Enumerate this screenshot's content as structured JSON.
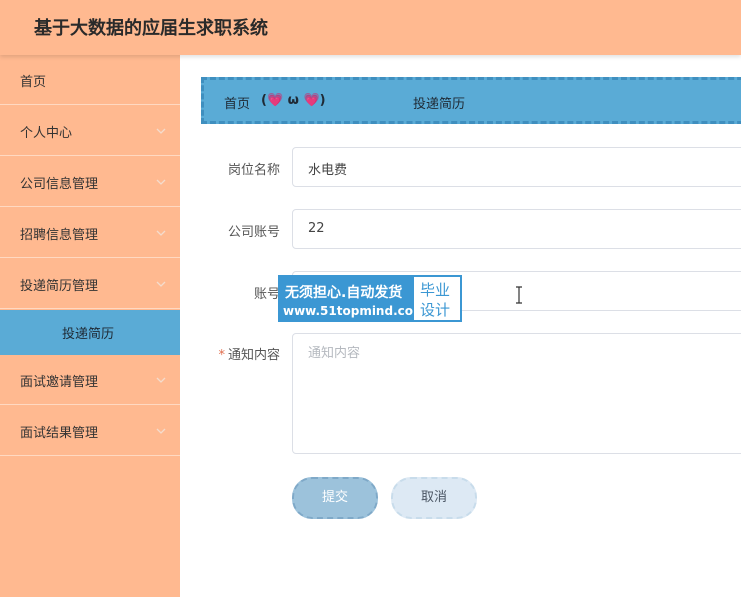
{
  "header": {
    "title": "基于大数据的应届生求职系统"
  },
  "sidebar": {
    "items": [
      {
        "label": "首页"
      },
      {
        "label": "个人中心"
      },
      {
        "label": "公司信息管理"
      },
      {
        "label": "招聘信息管理"
      },
      {
        "label": "投递简历管理"
      },
      {
        "label": "面试邀请管理"
      },
      {
        "label": "面试结果管理"
      }
    ],
    "active_sub": {
      "label": "投递简历"
    }
  },
  "breadcrumb": {
    "home": "首页",
    "separator": "(💗 ω 💗)",
    "current": "投递简历"
  },
  "form": {
    "position_name": {
      "label": "岗位名称",
      "value": "水电费"
    },
    "company_account": {
      "label": "公司账号",
      "value": "22"
    },
    "account": {
      "label": "账号"
    },
    "notice_content": {
      "required_mark": "*",
      "label": "通知内容",
      "placeholder": "通知内容"
    },
    "submit_label": "提交",
    "cancel_label": "取消"
  },
  "watermark": {
    "line1": "无须担心.自动发货",
    "line2": "www.51topmind.com",
    "badge_line1": "毕业",
    "badge_line2": "设计"
  },
  "colors": {
    "header_bg": "#ffb990",
    "sidebar_bg": "#ffb990",
    "accent": "#5aabd6",
    "submit_bg": "#9cc2db",
    "cancel_bg": "#dde9f4",
    "required": "#e06d4d"
  },
  "icons": {
    "submenu_toggle": "chevron-down-icon",
    "cursor": "text-cursor-icon"
  }
}
